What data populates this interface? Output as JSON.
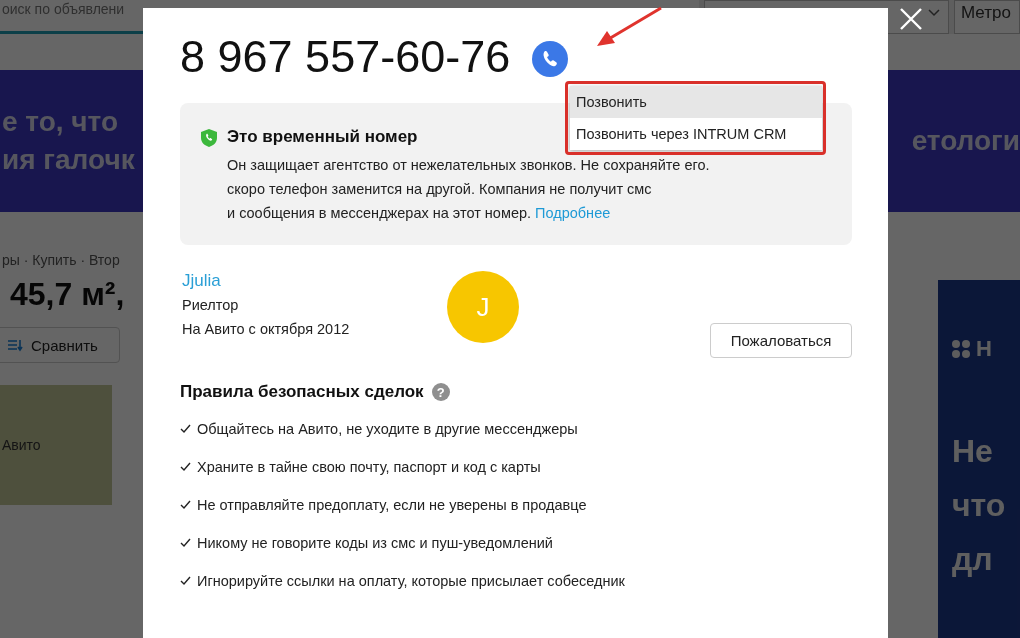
{
  "background_page": {
    "search_field": {
      "placeholder": "оиск по объявлени"
    },
    "metro_field": {
      "value": "Метро"
    },
    "banner": {
      "lines": [
        "е то, что",
        "ия галочк"
      ],
      "right_text": "етологи"
    },
    "breadcrumbs": "ры · Купить · Втор",
    "title": "45,7 м²,",
    "compare_button": "Сравнить",
    "promo_block": {
      "text": "Авито"
    },
    "ad_panel": {
      "logo_text": "Н",
      "lines": [
        "Не",
        "что",
        "дл"
      ]
    }
  },
  "dialog": {
    "phone": "8 967 557-60-76",
    "call_menu": [
      {
        "label": "Позвонить",
        "selected": true
      },
      {
        "label": "Позвонить через INTRUM CRM",
        "selected": false
      }
    ],
    "notice": {
      "title": "Это временный номер",
      "text": "Он защищает агентство от нежелательных звонков. Не сохраняйте его.\nскоро телефон заменится на другой. Компания не получит смс\nи сообщения в мессенджерах на этот номер.",
      "link": "Подробнее"
    },
    "seller": {
      "name": "Jjulia",
      "role": "Риелтор",
      "since": "На Авито с октября 2012",
      "avatar_letter": "J"
    },
    "report_button": "Пожаловаться",
    "rules": {
      "title": "Правила безопасных сделок",
      "help": "?",
      "items": [
        "Общайтесь на Авито, не уходите в другие мессенджеры",
        "Храните в тайне свою почту, паспорт и код с карты",
        "Не отправляйте предоплату, если не уверены в продавце",
        "Никому не говорите коды из смс и пуш-уведомлений",
        "Игнорируйте ссылки на оплату, которые присылает собеседник"
      ]
    }
  }
}
